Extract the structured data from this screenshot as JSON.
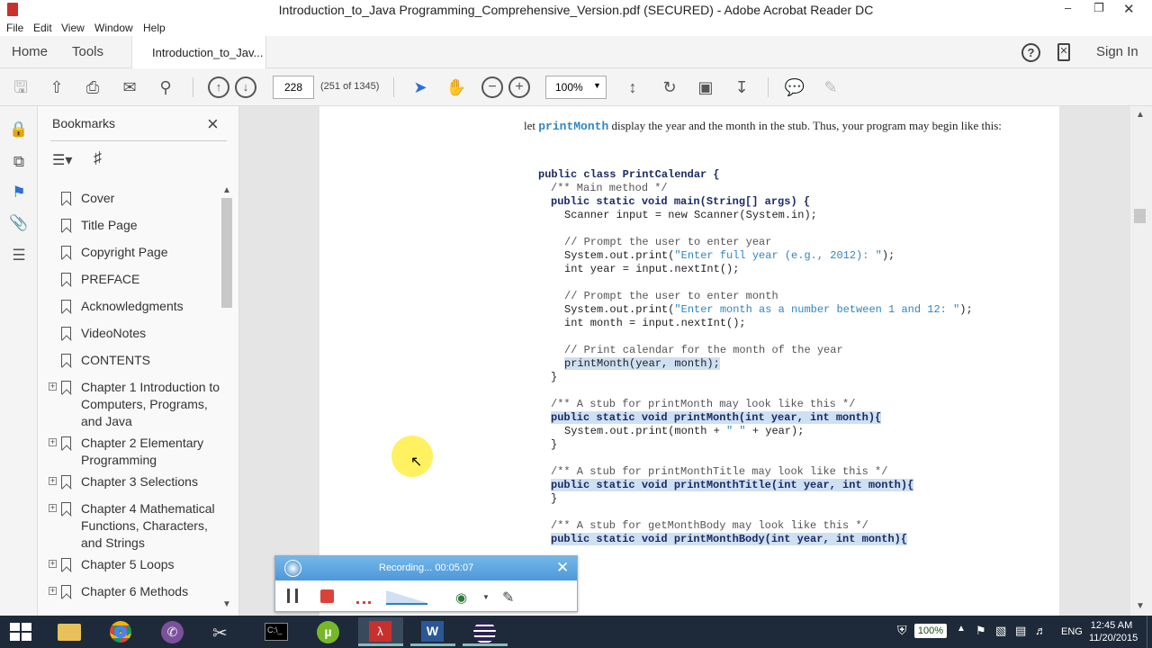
{
  "window": {
    "title": "Introduction_to_Java Programming_Comprehensive_Version.pdf (SECURED) - Adobe Acrobat Reader DC"
  },
  "menu": [
    "File",
    "Edit",
    "View",
    "Window",
    "Help"
  ],
  "tabs": {
    "home": "Home",
    "tools": "Tools",
    "document": "Introduction_to_Jav...",
    "sign_in": "Sign In"
  },
  "toolbar": {
    "page_number": "228",
    "page_count": "(251 of 1345)",
    "zoom": "100%"
  },
  "bookmarks": {
    "title": "Bookmarks",
    "items": [
      {
        "label": "Cover",
        "expandable": false
      },
      {
        "label": "Title Page",
        "expandable": false
      },
      {
        "label": "Copyright Page",
        "expandable": false
      },
      {
        "label": "PREFACE",
        "expandable": false
      },
      {
        "label": "Acknowledgments",
        "expandable": false
      },
      {
        "label": "VideoNotes",
        "expandable": false
      },
      {
        "label": "CONTENTS",
        "expandable": false
      },
      {
        "label": "Chapter 1 Introduction to Computers, Programs, and Java",
        "expandable": true
      },
      {
        "label": "Chapter 2 Elementary Programming",
        "expandable": true
      },
      {
        "label": "Chapter 3 Selections",
        "expandable": true
      },
      {
        "label": "Chapter 4 Mathematical Functions, Characters, and Strings",
        "expandable": true
      },
      {
        "label": "Chapter 5 Loops",
        "expandable": true
      },
      {
        "label": "Chapter 6 Methods",
        "expandable": true
      }
    ]
  },
  "document": {
    "prose_before": "let ",
    "prose_code": "printMonth",
    "prose_after": " display the year and the month in the stub. Thus, your program may begin like this:",
    "code": {
      "l1": "public class PrintCalendar {",
      "l2": "/** Main method */",
      "l3": "public static void main(String[] args) {",
      "l4": "Scanner input = new Scanner(System.in);",
      "l5": "// Prompt the user to enter year",
      "l6a": "System.out.print(",
      "l6s": "\"Enter full year (e.g., 2012): \"",
      "l6b": ");",
      "l7": "int year = input.nextInt();",
      "l8": "// Prompt the user to enter month",
      "l9s": "\"Enter month as a number between 1 and 12: \"",
      "l10": "int month = input.nextInt();",
      "l11": "// Print calendar for the month of the year",
      "l12": "printMonth(year, month);",
      "l13": "}",
      "l14": "/** A stub for printMonth may look like this */",
      "l15": "public static void printMonth(int year, int month){",
      "l16a": "System.out.print(month + ",
      "l16s": "\" \"",
      "l16b": " + year);",
      "l17": "}",
      "l18": "/** A stub for printMonthTitle may look like this */",
      "l19": "public static void printMonthTitle(int year, int month){",
      "l20": "}",
      "l21": "/** A stub for getMonthBody may look like this */",
      "l22": "public static void printMonthBody(int year, int month){"
    }
  },
  "recorder": {
    "status": "Recording... 00:05:07"
  },
  "taskbar": {
    "battery": "100%",
    "language": "ENG",
    "time": "12:45 AM",
    "date": "11/20/2015"
  }
}
